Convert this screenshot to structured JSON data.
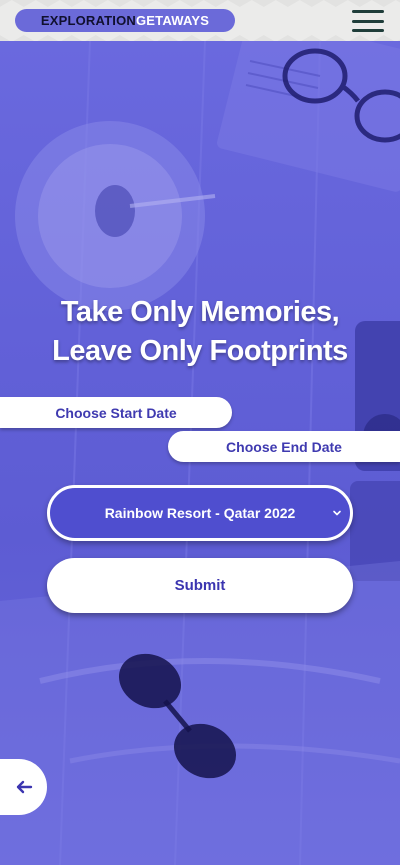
{
  "header": {
    "logo_part1": "EXPLORATION",
    "logo_part2": "GETAWAYS",
    "menu_icon": "hamburger-menu-icon"
  },
  "hero": {
    "title_line1": "Take Only Memories,",
    "title_line2": "Leave Only Footprints"
  },
  "form": {
    "start_date_label": "Choose Start Date",
    "end_date_label": "Choose End Date",
    "resort_selected": "Rainbow Resort - Qatar 2022",
    "submit_label": "Submit"
  },
  "nav": {
    "back_icon": "arrow-left-icon"
  },
  "colors": {
    "primary": "#5f5ed6",
    "accent_text": "#3f3ab0",
    "header_bg": "#ebebea"
  }
}
